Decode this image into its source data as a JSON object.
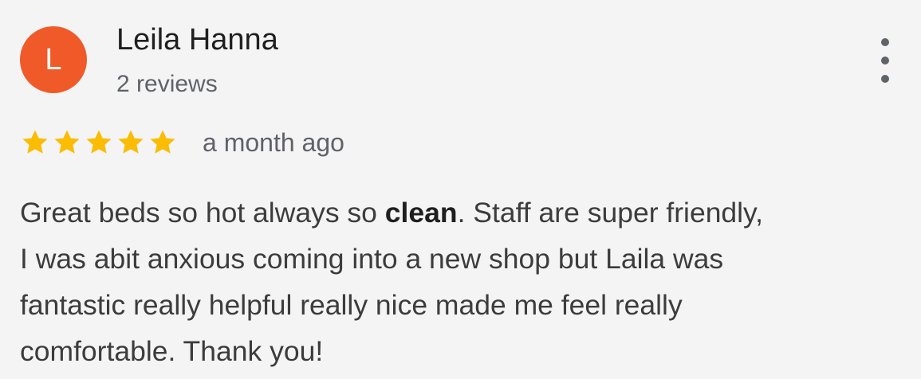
{
  "reviewer": {
    "initial": "L",
    "name": "Leila Hanna",
    "review_count": "2 reviews",
    "avatar_color": "#f05a28"
  },
  "rating": {
    "stars": 5,
    "max": 5,
    "star_color": "#fbbc04"
  },
  "time_ago": "a month ago",
  "review": {
    "line1_before": "Great beds so hot always so ",
    "line1_bold": "clean",
    "line1_after": ". Staff are super friendly,",
    "line2": "I was abit anxious coming into a new shop but Laila was",
    "line3": "fantastic really helpful really nice made me feel really",
    "line4": "comfortable. Thank you!"
  },
  "menu_icon": "more-vert-icon"
}
